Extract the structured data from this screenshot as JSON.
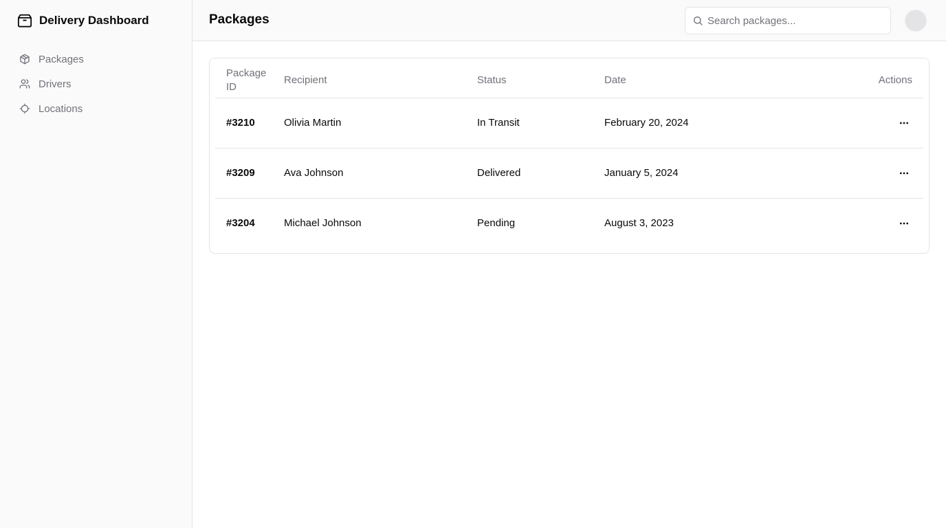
{
  "app": {
    "title": "Delivery Dashboard"
  },
  "sidebar": {
    "items": [
      {
        "label": "Packages",
        "icon": "package-icon"
      },
      {
        "label": "Drivers",
        "icon": "users-icon"
      },
      {
        "label": "Locations",
        "icon": "crosshair-icon"
      }
    ]
  },
  "header": {
    "title": "Packages",
    "search_placeholder": "Search packages..."
  },
  "table": {
    "columns": [
      "Package ID",
      "Recipient",
      "Status",
      "Date",
      "Actions"
    ],
    "rows": [
      {
        "id": "#3210",
        "recipient": "Olivia Martin",
        "status": "In Transit",
        "date": "February 20, 2024"
      },
      {
        "id": "#3209",
        "recipient": "Ava Johnson",
        "status": "Delivered",
        "date": "January 5, 2024"
      },
      {
        "id": "#3204",
        "recipient": "Michael Johnson",
        "status": "Pending",
        "date": "August 3, 2023"
      }
    ]
  },
  "colors": {
    "sidebar_bg": "#fafafa",
    "border": "#e4e4e7",
    "muted_text": "#71717a",
    "text": "#09090b"
  }
}
